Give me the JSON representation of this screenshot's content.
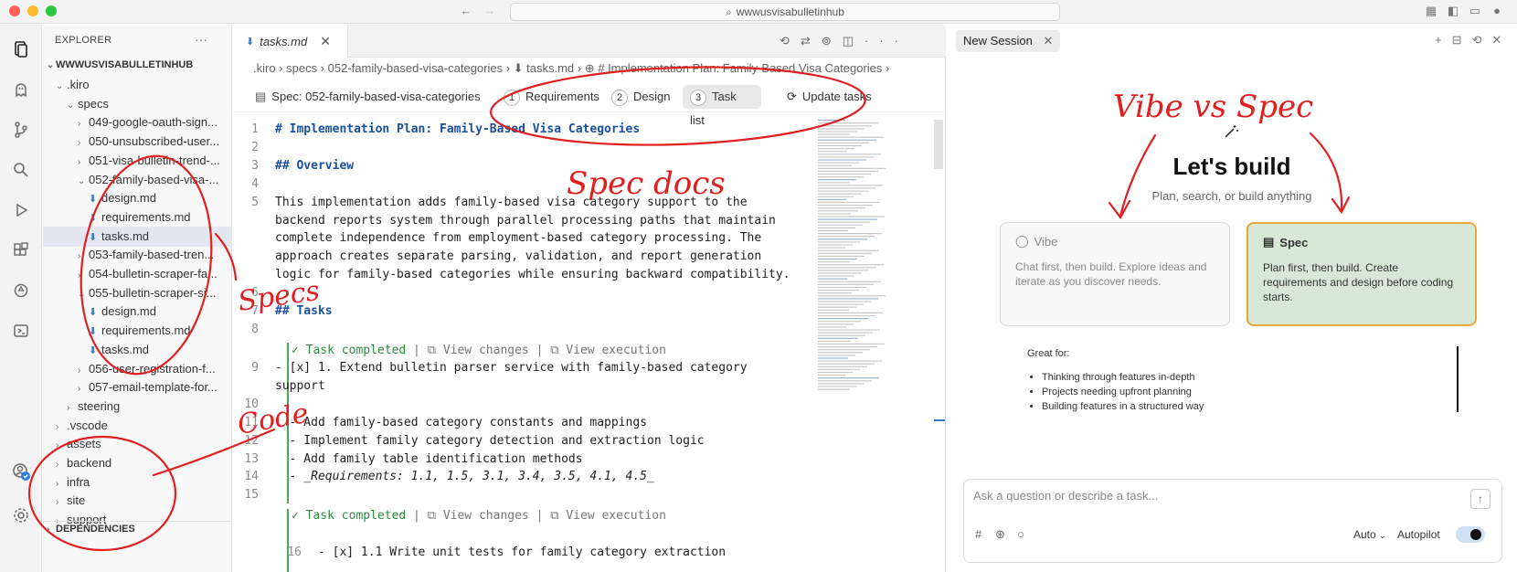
{
  "window": {
    "search": "wwwusvisabulletinhub"
  },
  "explorer": {
    "title": "EXPLORER",
    "root": "WWWUSVISABULLETINHUB",
    "items": [
      {
        "label": ".kiro",
        "chev": "⌄",
        "indent": 14
      },
      {
        "label": "specs",
        "chev": "⌄",
        "indent": 26
      },
      {
        "label": "049-google-oauth-sign...",
        "chev": "›",
        "indent": 38
      },
      {
        "label": "050-unsubscribed-user...",
        "chev": "›",
        "indent": 38
      },
      {
        "label": "051-visa-bulletin-trend-...",
        "chev": "›",
        "indent": 38
      },
      {
        "label": "052-family-based-visa-...",
        "chev": "⌄",
        "indent": 38
      },
      {
        "label": "design.md",
        "md": true,
        "indent": 50
      },
      {
        "label": "requirements.md",
        "md": true,
        "indent": 50
      },
      {
        "label": "tasks.md",
        "md": true,
        "indent": 50,
        "selected": true
      },
      {
        "label": "053-family-based-tren...",
        "chev": "›",
        "indent": 38
      },
      {
        "label": "054-bulletin-scraper-fa...",
        "chev": "›",
        "indent": 38
      },
      {
        "label": "055-bulletin-scraper-si...",
        "chev": "⌄",
        "indent": 38
      },
      {
        "label": "design.md",
        "md": true,
        "indent": 50
      },
      {
        "label": "requirements.md",
        "md": true,
        "indent": 50
      },
      {
        "label": "tasks.md",
        "md": true,
        "indent": 50
      },
      {
        "label": "056-user-registration-f...",
        "chev": "›",
        "indent": 38
      },
      {
        "label": "057-email-template-for...",
        "chev": "›",
        "indent": 38
      },
      {
        "label": "steering",
        "chev": "›",
        "indent": 26
      },
      {
        "label": ".vscode",
        "chev": "›",
        "indent": 14
      },
      {
        "label": "assets",
        "chev": "›",
        "indent": 14
      },
      {
        "label": "backend",
        "chev": "›",
        "indent": 14
      },
      {
        "label": "infra",
        "chev": "›",
        "indent": 14
      },
      {
        "label": "site",
        "chev": "›",
        "indent": 14
      },
      {
        "label": "support",
        "chev": "›",
        "indent": 14
      }
    ],
    "dependencies": "DEPENDENCIES"
  },
  "editor": {
    "tab": "tasks.md",
    "breadcrumb": ".kiro  ›  specs  ›  052-family-based-visa-categories  ›  ⬇ tasks.md  ›  ⊕ # Implementation Plan: Family-Based Visa Categories  ›",
    "spec_label": "Spec: 052-family-based-visa-categories",
    "steps": [
      {
        "n": "1",
        "label": "Requirements"
      },
      {
        "n": "2",
        "label": "Design"
      },
      {
        "n": "3",
        "label": "Task list"
      }
    ],
    "update": "Update tasks",
    "lines": [
      {
        "n": "1",
        "text": "# Implementation Plan: Family-Based Visa Categories",
        "cls": "h1"
      },
      {
        "n": "2",
        "text": "",
        "cls": "txt"
      },
      {
        "n": "3",
        "text": "## Overview",
        "cls": "h1"
      },
      {
        "n": "4",
        "text": "",
        "cls": "txt"
      },
      {
        "n": "5",
        "text": "This implementation adds family-based visa category support to the",
        "cls": "txt"
      },
      {
        "n": "",
        "text": "backend reports system through parallel processing paths that maintain",
        "cls": "txt"
      },
      {
        "n": "",
        "text": "complete independence from employment-based category processing. The",
        "cls": "txt"
      },
      {
        "n": "",
        "text": "approach creates separate parsing, validation, and report generation",
        "cls": "txt"
      },
      {
        "n": "",
        "text": "logic for family-based categories while ensuring backward compatibility.",
        "cls": "txt"
      },
      {
        "n": "6",
        "text": "",
        "cls": "txt"
      },
      {
        "n": "7",
        "text": "## Tasks",
        "cls": "h1"
      },
      {
        "n": "8",
        "text": "",
        "cls": "txt"
      }
    ],
    "task1": {
      "meta_done": "✓ Task completed",
      "meta_changes": "View changes",
      "meta_exec": "View execution",
      "lines": [
        {
          "n": "9",
          "text": "- [x] 1. Extend bulletin parser service with family-based category"
        },
        {
          "n": "",
          "text": "support"
        },
        {
          "n": "10",
          "text": ""
        },
        {
          "n": "11",
          "text": "  - Add family-based category constants and mappings"
        },
        {
          "n": "12",
          "text": "  - Implement family category detection and extraction logic"
        },
        {
          "n": "13",
          "text": "  - Add family table identification methods"
        },
        {
          "n": "14",
          "text": "  - _Requirements: 1.1, 1.5, 3.1, 3.4, 3.5, 4.1, 4.5_"
        },
        {
          "n": "15",
          "text": ""
        }
      ]
    },
    "task2": {
      "meta_done": "✓ Task completed",
      "meta_changes": "View changes",
      "meta_exec": "View execution",
      "line": {
        "n": "16",
        "text": "- [x] 1.1 Write unit tests for family category extraction"
      }
    }
  },
  "chat": {
    "tab": "New Session",
    "heading": "Let's build",
    "sub": "Plan, search, or build anything",
    "vibe": {
      "title": "Vibe",
      "desc": "Chat first, then build. Explore ideas and iterate as you discover needs."
    },
    "spec": {
      "title": "Spec",
      "desc": "Plan first, then build. Create requirements and design before coding starts."
    },
    "great_for": "Great for:",
    "bullets": [
      "Thinking through features in-depth",
      "Projects needing upfront planning",
      "Building features in a structured way"
    ],
    "input_placeholder": "Ask a question or describe a task...",
    "mode": "Auto",
    "autopilot": "Autopilot"
  },
  "annotations": {
    "vibe_vs_spec": "Vibe vs Spec",
    "spec_docs": "Spec docs",
    "specs": "Specs",
    "code": "Code"
  },
  "colors": {
    "accent": "#e6a83b",
    "annotation": "#e02020",
    "spec_card": "#d7e8d6",
    "heading": "#1a4fa0"
  }
}
